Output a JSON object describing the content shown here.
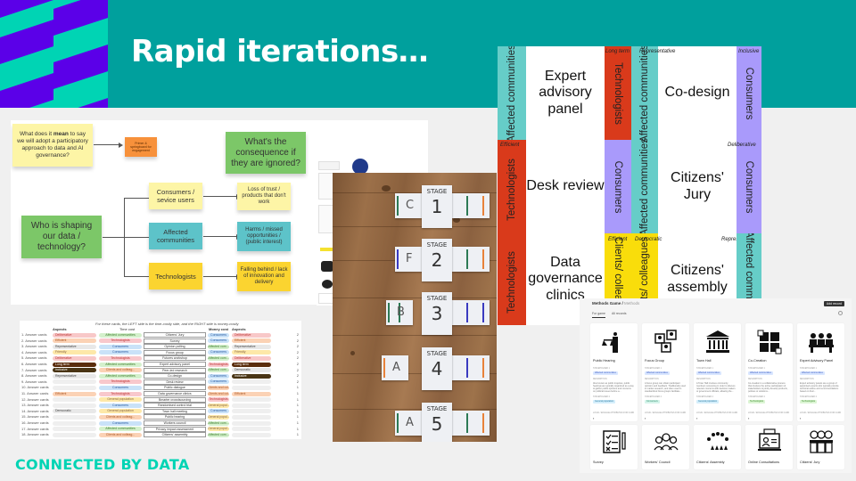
{
  "slide": {
    "title": "Rapid iterations…",
    "brand": "CONNECTED BY DATA",
    "colors": {
      "header": "#00a09d",
      "brand_mint": "#00d4b4",
      "brand_purple": "#5b00e8"
    }
  },
  "miro_board": {
    "question_note": "What does it mean to say we will adopt a participatory approach to data and AI governance?",
    "question_bold_word": "mean",
    "primer_note": "Primer & springboard for engagement",
    "central_question": "Who is shaping our data / technology?",
    "consequence_question": "What's the consequence if they are ignored?",
    "groups": [
      {
        "name": "Consumers / sevice users",
        "consequence": "Loss of trust / products that don't work"
      },
      {
        "name": "Affected communities",
        "consequence": "Harms / missed opportunities / (public interest)"
      },
      {
        "name": "Technologists",
        "consequence": "Falling behind / lack of innovation and delivery"
      }
    ]
  },
  "spreadsheet": {
    "note": "For these cards, the LEFT side is the time-costly side, and the RIGHT side is money-costly",
    "headers": {
      "aspects_left": "Aspects",
      "time_cost": "Time cost",
      "money_cost": "Money cost",
      "aspects_right": "Aspects"
    },
    "rows": [
      {
        "label": "1. Answer cards",
        "aspect_l": "Deliberative",
        "time": "Affected communities",
        "method": "Citizens' Jury",
        "money": "Consumers",
        "aspect_r": "Deliberative",
        "count": "2"
      },
      {
        "label": "2. Answer cards",
        "aspect_l": "Efficient",
        "time": "Technologists",
        "method": "Survey",
        "money": "Consumers",
        "aspect_r": "Efficient",
        "count": "2"
      },
      {
        "label": "3. Answer cards",
        "aspect_l": "Representative",
        "time": "Consumers",
        "method": "Opinion polling",
        "money": "Affected com...",
        "aspect_r": "Representative",
        "count": "2"
      },
      {
        "label": "4. Answer cards",
        "aspect_l": "Friendly",
        "time": "Consumers",
        "method": "Focus group",
        "money": "Consumers",
        "aspect_r": "Friendly",
        "count": "2"
      },
      {
        "label": "5. Answer cards",
        "aspect_l": "Deliberative",
        "time": "Technologists",
        "method": "Futures workshop",
        "money": "Affected com...",
        "aspect_r": "Deliberative",
        "count": "2"
      },
      {
        "label": "6. Answer cards",
        "aspect_l": "Long term",
        "time": "Affected communities",
        "method": "Expert advisory panel",
        "money": "Technologists",
        "aspect_r": "Long term",
        "count": "2"
      },
      {
        "label": "7. Answer cards",
        "aspect_l": "Inclusive",
        "time": "Clients and colleag...",
        "method": "Peer-led research",
        "money": "Affected com...",
        "aspect_r": "Democratic",
        "count": "2"
      },
      {
        "label": "8. Answer cards",
        "aspect_l": "Representative",
        "time": "Affected communities",
        "method": "Co-design",
        "money": "Consumers",
        "aspect_r": "Inclusive",
        "count": "2"
      },
      {
        "label": "9. Answer cards",
        "aspect_l": "",
        "time": "Technologists",
        "method": "Desk review",
        "money": "Consumers",
        "aspect_r": "",
        "count": "2"
      },
      {
        "label": "10. Answer cards",
        "aspect_l": "",
        "time": "Consumers",
        "method": "Public dialogue",
        "money": "Clients and col...",
        "aspect_r": "",
        "count": "1"
      },
      {
        "label": "11. Answer cards",
        "aspect_l": "Efficient",
        "time": "Technologists",
        "method": "Data governance clinics",
        "money": "Clients and col...",
        "aspect_r": "Efficient",
        "count": "1"
      },
      {
        "label": "12. Answer cards",
        "aspect_l": "",
        "time": "General population",
        "method": "Bmarter crowdsourcing",
        "money": "Technologists",
        "aspect_r": "",
        "count": "1"
      },
      {
        "label": "13. Answer cards",
        "aspect_l": "",
        "time": "Consumers",
        "method": "Randomised control trial",
        "money": "General popul...",
        "aspect_r": "",
        "count": "1"
      },
      {
        "label": "14. Answer cards",
        "aspect_l": "Democratic",
        "time": "General population",
        "method": "Town hall meeting",
        "money": "Consumers",
        "aspect_r": "",
        "count": "1"
      },
      {
        "label": "15. Answer cards",
        "aspect_l": "",
        "time": "Clients and colleag...",
        "method": "Public hearing",
        "money": "General popul...",
        "aspect_r": "",
        "count": "1"
      },
      {
        "label": "16. Answer cards",
        "aspect_l": "",
        "time": "Consumers",
        "method": "Workers council",
        "money": "Affected com...",
        "aspect_r": "",
        "count": "1"
      },
      {
        "label": "17. Answer cards",
        "aspect_l": "",
        "time": "Affected communities",
        "method": "Privacy impact assessment",
        "money": "General popul...",
        "aspect_r": "",
        "count": "1"
      },
      {
        "label": "18. Answer cards",
        "aspect_l": "",
        "time": "Clients and colleag...",
        "method": "Citizens' assembly",
        "money": "Affected com...",
        "aspect_r": "",
        "count": "1"
      }
    ]
  },
  "photo": {
    "stages": [
      {
        "label": "STAGE",
        "number": "1",
        "letter": "C"
      },
      {
        "label": "STAGE",
        "number": "2",
        "letter": "F"
      },
      {
        "label": "STAGE",
        "number": "3",
        "letter": "B"
      },
      {
        "label": "STAGE",
        "number": "4",
        "letter": "A"
      },
      {
        "label": "STAGE",
        "number": "5",
        "letter": "A"
      }
    ]
  },
  "card_grid": {
    "cells": [
      {
        "method": "Expert advisory panel",
        "left": "Affected communities",
        "right": "Technologists",
        "tag": "Long term"
      },
      {
        "method": "Co-design",
        "left": "Affected communities",
        "right": "Consumers",
        "tag_left": "Representative",
        "tag": "Inclusive"
      },
      {
        "method": "Desk review",
        "left": "Technologists",
        "right": "Consumers",
        "tag_left": "Efficient"
      },
      {
        "method": "Citizens' Jury",
        "left": "Affected communities",
        "right": "Consumers",
        "tag": "Deliberative"
      },
      {
        "method": "Data governance clinics",
        "left": "Technologists",
        "right": "Clients/ colleagues",
        "tag_right_a": "Efficient"
      },
      {
        "method": "Citizens' assembly",
        "left": "Clients/ colleagues",
        "right": "Affected communities",
        "tag_left": "Democratic",
        "tag": "Representative"
      }
    ]
  },
  "methods_page": {
    "breadcrumb_app": "Methods Game",
    "breadcrumb_page": "Methods",
    "add_button": "Add record",
    "tabs": [
      "For game",
      "All records"
    ],
    "stakeholder_label": "STAKEHOLDER 1",
    "description_label": "DESCRIPTION",
    "stakeholder2_label": "STAKEHOLDER 2",
    "footer_label": "LOGIC / ENGAGE ATTRIBUTES FOR CARD",
    "cards_row1": [
      {
        "name": "Public Hearing",
        "stakeholder": "Affected communities",
        "description": "Also known as public inquiries, public hearings are typically organized as a way to gather public opinions and concerns on political issues before a...",
        "stakeholder2": "General population",
        "icon": "gavel-scales-icon"
      },
      {
        "name": "Focus Group",
        "stakeholder": "Affected communities",
        "description": "A focus group can obtain participant opinions and feedback. Traditionally used in market research, and often used in standardized focus groups facilitate...",
        "stakeholder2": "Consumers",
        "icon": "people-chat-icon"
      },
      {
        "name": "Town Hall",
        "stakeholder": "Affected communities",
        "description": "A Town Hall involves community members convening in order to discuss relevant concerns with decision makers or government officials, allowing the...",
        "stakeholder2": "General population",
        "icon": "town-hall-building-icon"
      },
      {
        "name": "Co-Creation",
        "stakeholder": "Affected communities",
        "description": "Co-creation is a collaborative process that involves the active participation of stakeholders to jointly develop products, policies or solutions...",
        "stakeholder2": "Technologists",
        "icon": "puzzle-hands-icon"
      },
      {
        "name": "Expert Advisory Panel",
        "stakeholder": "Affected communities",
        "description": "Expert advisory panels are a group of appointed experts who typically provide technical advice and recommendations based on their...",
        "stakeholder2": "Technologists",
        "icon": "panel-people-icon"
      }
    ],
    "cards_row2": [
      {
        "name": "Survey",
        "icon": "checklist-pencil-icon"
      },
      {
        "name": "Workers' Council",
        "icon": "workers-helmets-icon"
      },
      {
        "name": "Citizens' Assembly",
        "icon": "assembly-circle-icon"
      },
      {
        "name": "Online Consultations",
        "icon": "laptop-person-icon"
      },
      {
        "name": "Citizens' Jury",
        "icon": "jury-box-icon"
      }
    ]
  }
}
